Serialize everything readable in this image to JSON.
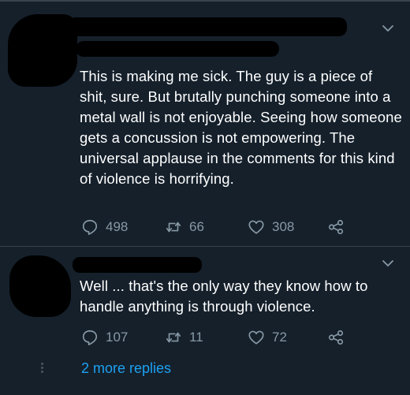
{
  "tweets": [
    {
      "text": "This is making me sick. The guy is a piece of shit, sure. But brutally punching someone into a metal wall is not enjoyable. Seeing how someone gets a concussion is not empowering. The universal applause in the comments for this kind of violence is horrifying.",
      "replies": "498",
      "retweets": "66",
      "likes": "308"
    },
    {
      "text": "Well ... that's the only way they know how to handle anything is through violence.",
      "replies": "107",
      "retweets": "11",
      "likes": "72"
    }
  ],
  "thread": {
    "more_replies": "2 more replies"
  },
  "icons": [
    "chevron-down-icon",
    "reply-icon",
    "retweet-icon",
    "like-icon",
    "share-icon"
  ],
  "colors": {
    "background": "#15202b",
    "text": "#ffffff",
    "muted": "#8899a6",
    "link": "#1da1f2"
  }
}
